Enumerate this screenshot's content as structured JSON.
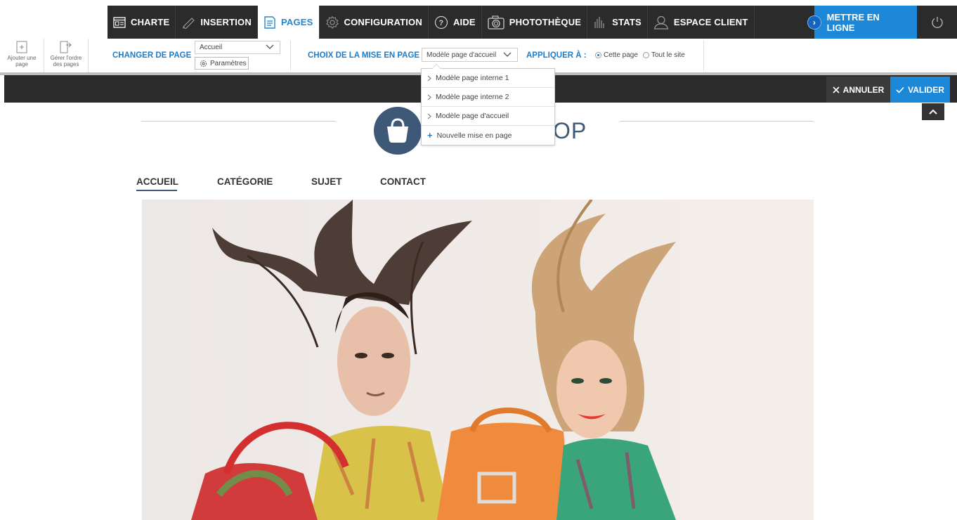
{
  "topnav": {
    "items": [
      {
        "label": "CHARTE",
        "icon": "layout-icon"
      },
      {
        "label": "INSERTION",
        "icon": "pencil-icon"
      },
      {
        "label": "PAGES",
        "icon": "pages-icon"
      },
      {
        "label": "CONFIGURATION",
        "icon": "gear-icon"
      },
      {
        "label": "AIDE",
        "icon": "help-icon"
      },
      {
        "label": "PHOTOTHÈQUE",
        "icon": "camera-icon"
      },
      {
        "label": "STATS",
        "icon": "stats-icon"
      },
      {
        "label": "ESPACE CLIENT",
        "icon": "user-icon"
      }
    ],
    "publish_label": "METTRE EN LIGNE",
    "accent": "#1e88d8",
    "dark": "#2b2b2b"
  },
  "toolbar": {
    "add_page": "Ajouter une page",
    "manage_order": "Gérer l'ordre des pages",
    "change_page_label": "CHANGER DE PAGE",
    "current_page": "Accueil",
    "params_label": "Paramètres",
    "layout_choice_label": "CHOIX DE LA MISE EN PAGE",
    "current_layout": "Modèle page d'accueil",
    "apply_to_label": "APPLIQUER À :",
    "radio_this_page": "Cette page",
    "radio_whole_site": "Tout le site"
  },
  "dropdown": {
    "items": [
      "Modèle page interne 1",
      "Modèle page interne 2",
      "Modèle page d'accueil"
    ],
    "new_layout": "Nouvelle mise en page"
  },
  "editbar": {
    "cancel": "ANNULER",
    "validate": "VALIDER"
  },
  "site": {
    "logo_text": "OP",
    "menu": [
      "ACCUEIL",
      "CATÉGORIE",
      "SUJET",
      "CONTACT"
    ],
    "brand_color": "#3e5878"
  }
}
